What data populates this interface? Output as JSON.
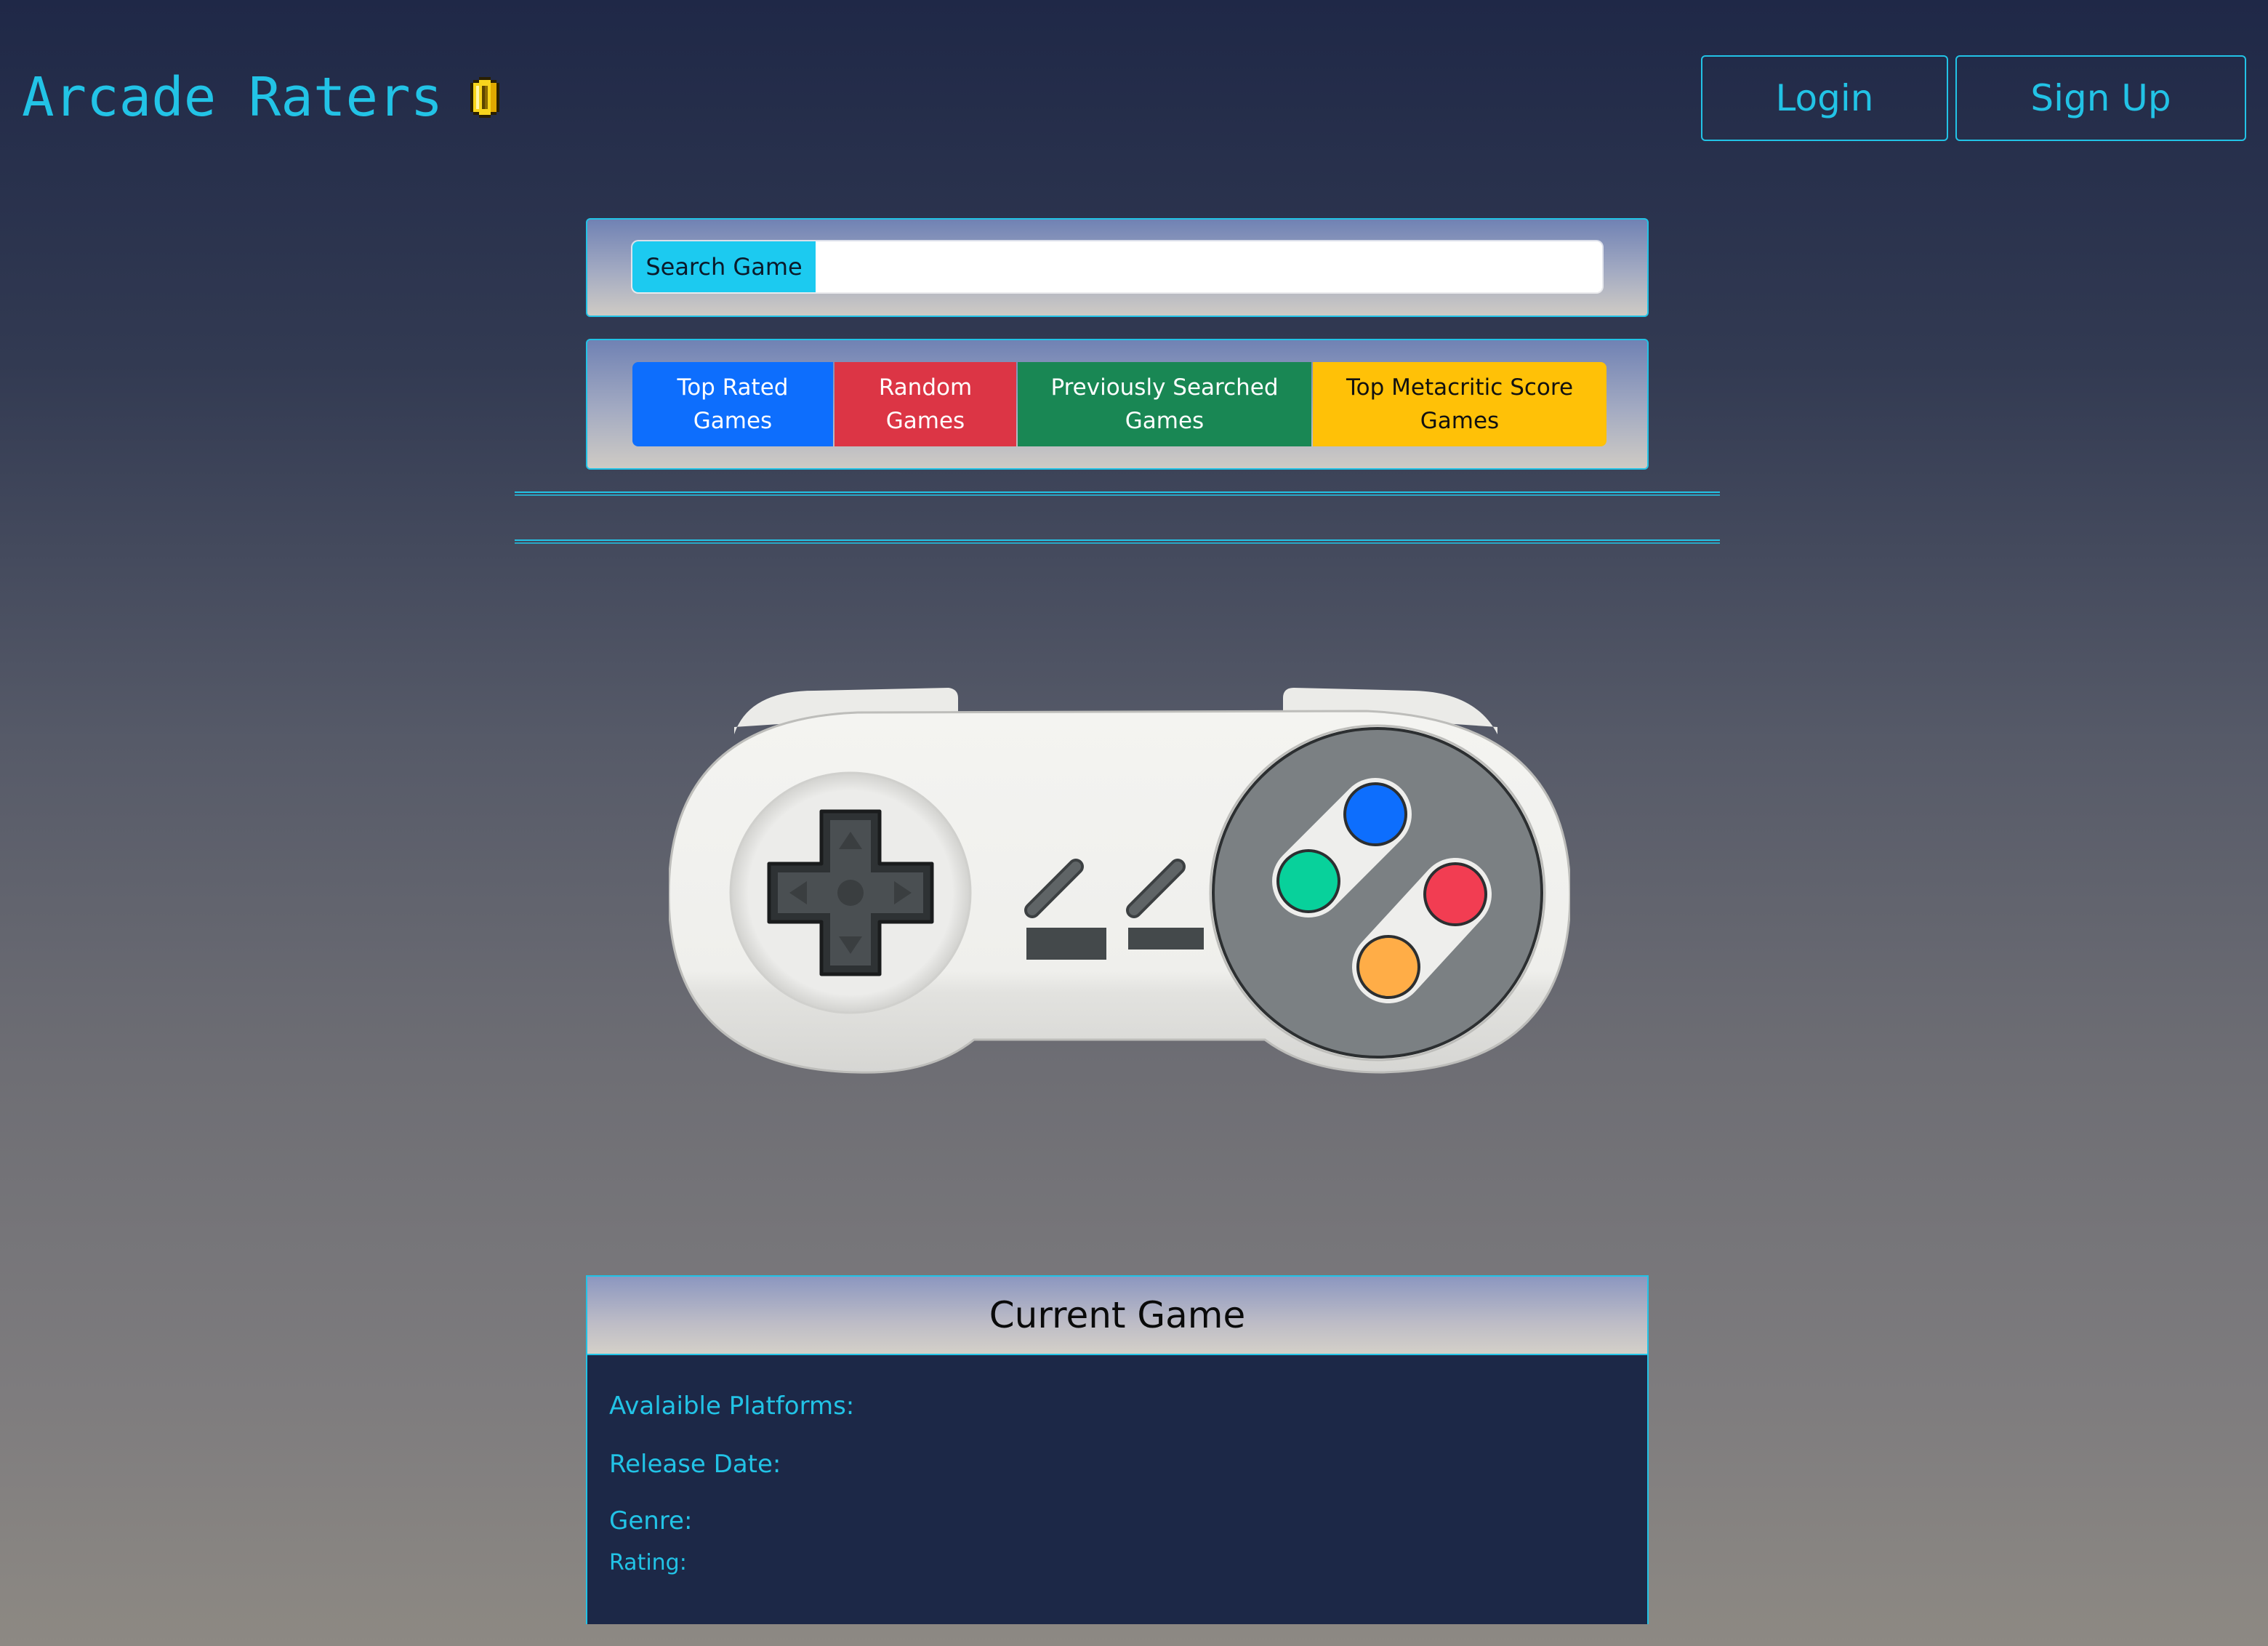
{
  "header": {
    "title": "Arcade Raters",
    "coin_icon": "coin-icon",
    "login_label": "Login",
    "signup_label": "Sign Up"
  },
  "search": {
    "label": "Search Game",
    "value": "",
    "placeholder": ""
  },
  "categories": [
    {
      "label": "Top Rated Games",
      "color": "#0d6efd"
    },
    {
      "label": "Random Games",
      "color": "#dc3545"
    },
    {
      "label": "Previously Searched Games",
      "color": "#198754"
    },
    {
      "label": "Top Metacritic Score Games",
      "color": "#ffc107"
    }
  ],
  "hero": {
    "icon": "game-controller-icon"
  },
  "current_game": {
    "title": "Current Game",
    "platforms_label": "Avalaible Platforms:",
    "release_label": "Release Date:",
    "genre_label": "Genre:",
    "rating_label": "Rating:"
  },
  "colors": {
    "accent": "#22c3e6",
    "card_body": "#1c2847"
  }
}
